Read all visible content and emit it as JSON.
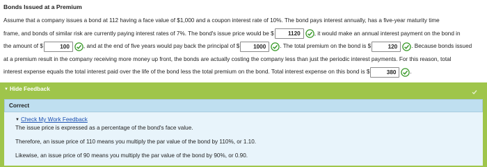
{
  "question": {
    "title": "Bonds Issued at a Premium",
    "p1": "Assume that a company issues a bond at 112 having a face value of $1,000 and a coupon interest rate of 10%. The bond pays interest annually, has a five-year maturity time",
    "p2a": "frame, and bonds of similar risk are currently paying interest rates of 7%. The bond's issue price would be $",
    "answer1": "1120",
    "p2b": ", it would make an annual interest payment on the bond in",
    "p3a": "the amount of $",
    "answer2": "100",
    "p3b": ", and at the end of five years would pay back the principal of $",
    "answer3": "1000",
    "p3c": ". The total premium on the bond is $",
    "answer4": "120",
    "p3d": ". Because bonds issued",
    "p4": "at a premium result in the company receiving more money up front, the bonds are actually costing the company less than just the periodic interest payments. For this reason, total",
    "p5a": "interest expense equals the total interest paid over the life of the bond less the total premium on the bond. Total interest expense on this bond is $",
    "answer5": "380",
    "p5b": "."
  },
  "feedback": {
    "toggle_label": "Hide Feedback",
    "status": "Correct",
    "work_link": "Check My Work Feedback",
    "line1": "The issue price is expressed as a percentage of the bond's face value.",
    "line2": "Therefore, an issue price of 110 means you multiply the par value of the bond by 110%, or 1.10.",
    "line3": "Likewise, an issue price of 90 means you multiply the par value of the bond by 90%, or 0.90."
  },
  "colors": {
    "check_green": "#3a9a2a",
    "feedback_green": "#9fc54b",
    "correct_blue": "#bfdff0",
    "link_blue": "#1a4fb0"
  },
  "icons": {
    "correct": "check-circle-icon",
    "toggle": "triangle-down-icon",
    "corner": "check-icon"
  }
}
